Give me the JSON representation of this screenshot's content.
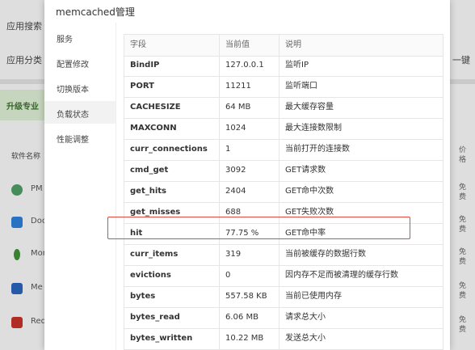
{
  "background": {
    "rows": [
      "应用搜索",
      "应用分类"
    ],
    "right_button": "一键",
    "upgrade_banner": "升级专业",
    "software_name_header": "软件名称",
    "price_header": "价格",
    "apps": [
      {
        "label": "PM",
        "icon": "gear-icon",
        "color": "#4c9a63"
      },
      {
        "label": "Doc",
        "icon": "docker-icon",
        "color": "#2b7cd3"
      },
      {
        "label": "Mon",
        "icon": "leaf-icon",
        "color": "#3d8c36"
      },
      {
        "label": "Me",
        "icon": "m-icon",
        "color": "#2a62b8"
      },
      {
        "label": "Red",
        "icon": "cube-icon",
        "color": "#c2302a"
      }
    ],
    "prices": [
      "免费",
      "免费",
      "免费",
      "免费",
      "免费"
    ]
  },
  "modal": {
    "title": "memcached管理",
    "menu": [
      {
        "label": "服务",
        "active": false
      },
      {
        "label": "配置修改",
        "active": false
      },
      {
        "label": "切换版本",
        "active": false
      },
      {
        "label": "负载状态",
        "active": true
      },
      {
        "label": "性能调整",
        "active": false
      }
    ],
    "table": {
      "headers": [
        "字段",
        "当前值",
        "说明"
      ],
      "rows": [
        [
          "BindIP",
          "127.0.0.1",
          "监听IP"
        ],
        [
          "PORT",
          "11211",
          "监听端口"
        ],
        [
          "CACHESIZE",
          "64 MB",
          "最大缓存容量"
        ],
        [
          "MAXCONN",
          "1024",
          "最大连接数限制"
        ],
        [
          "curr_connections",
          "1",
          "当前打开的连接数"
        ],
        [
          "cmd_get",
          "3092",
          "GET请求数"
        ],
        [
          "get_hits",
          "2404",
          "GET命中次数"
        ],
        [
          "get_misses",
          "688",
          "GET失败次数"
        ],
        [
          "hit",
          "77.75 %",
          "GET命中率"
        ],
        [
          "curr_items",
          "319",
          "当前被缓存的数据行数"
        ],
        [
          "evictions",
          "0",
          "因内存不足而被清理的缓存行数"
        ],
        [
          "bytes",
          "557.58 KB",
          "当前已使用内存"
        ],
        [
          "bytes_read",
          "6.06 MB",
          "请求总大小"
        ],
        [
          "bytes_written",
          "10.22 MB",
          "发送总大小"
        ]
      ]
    }
  }
}
